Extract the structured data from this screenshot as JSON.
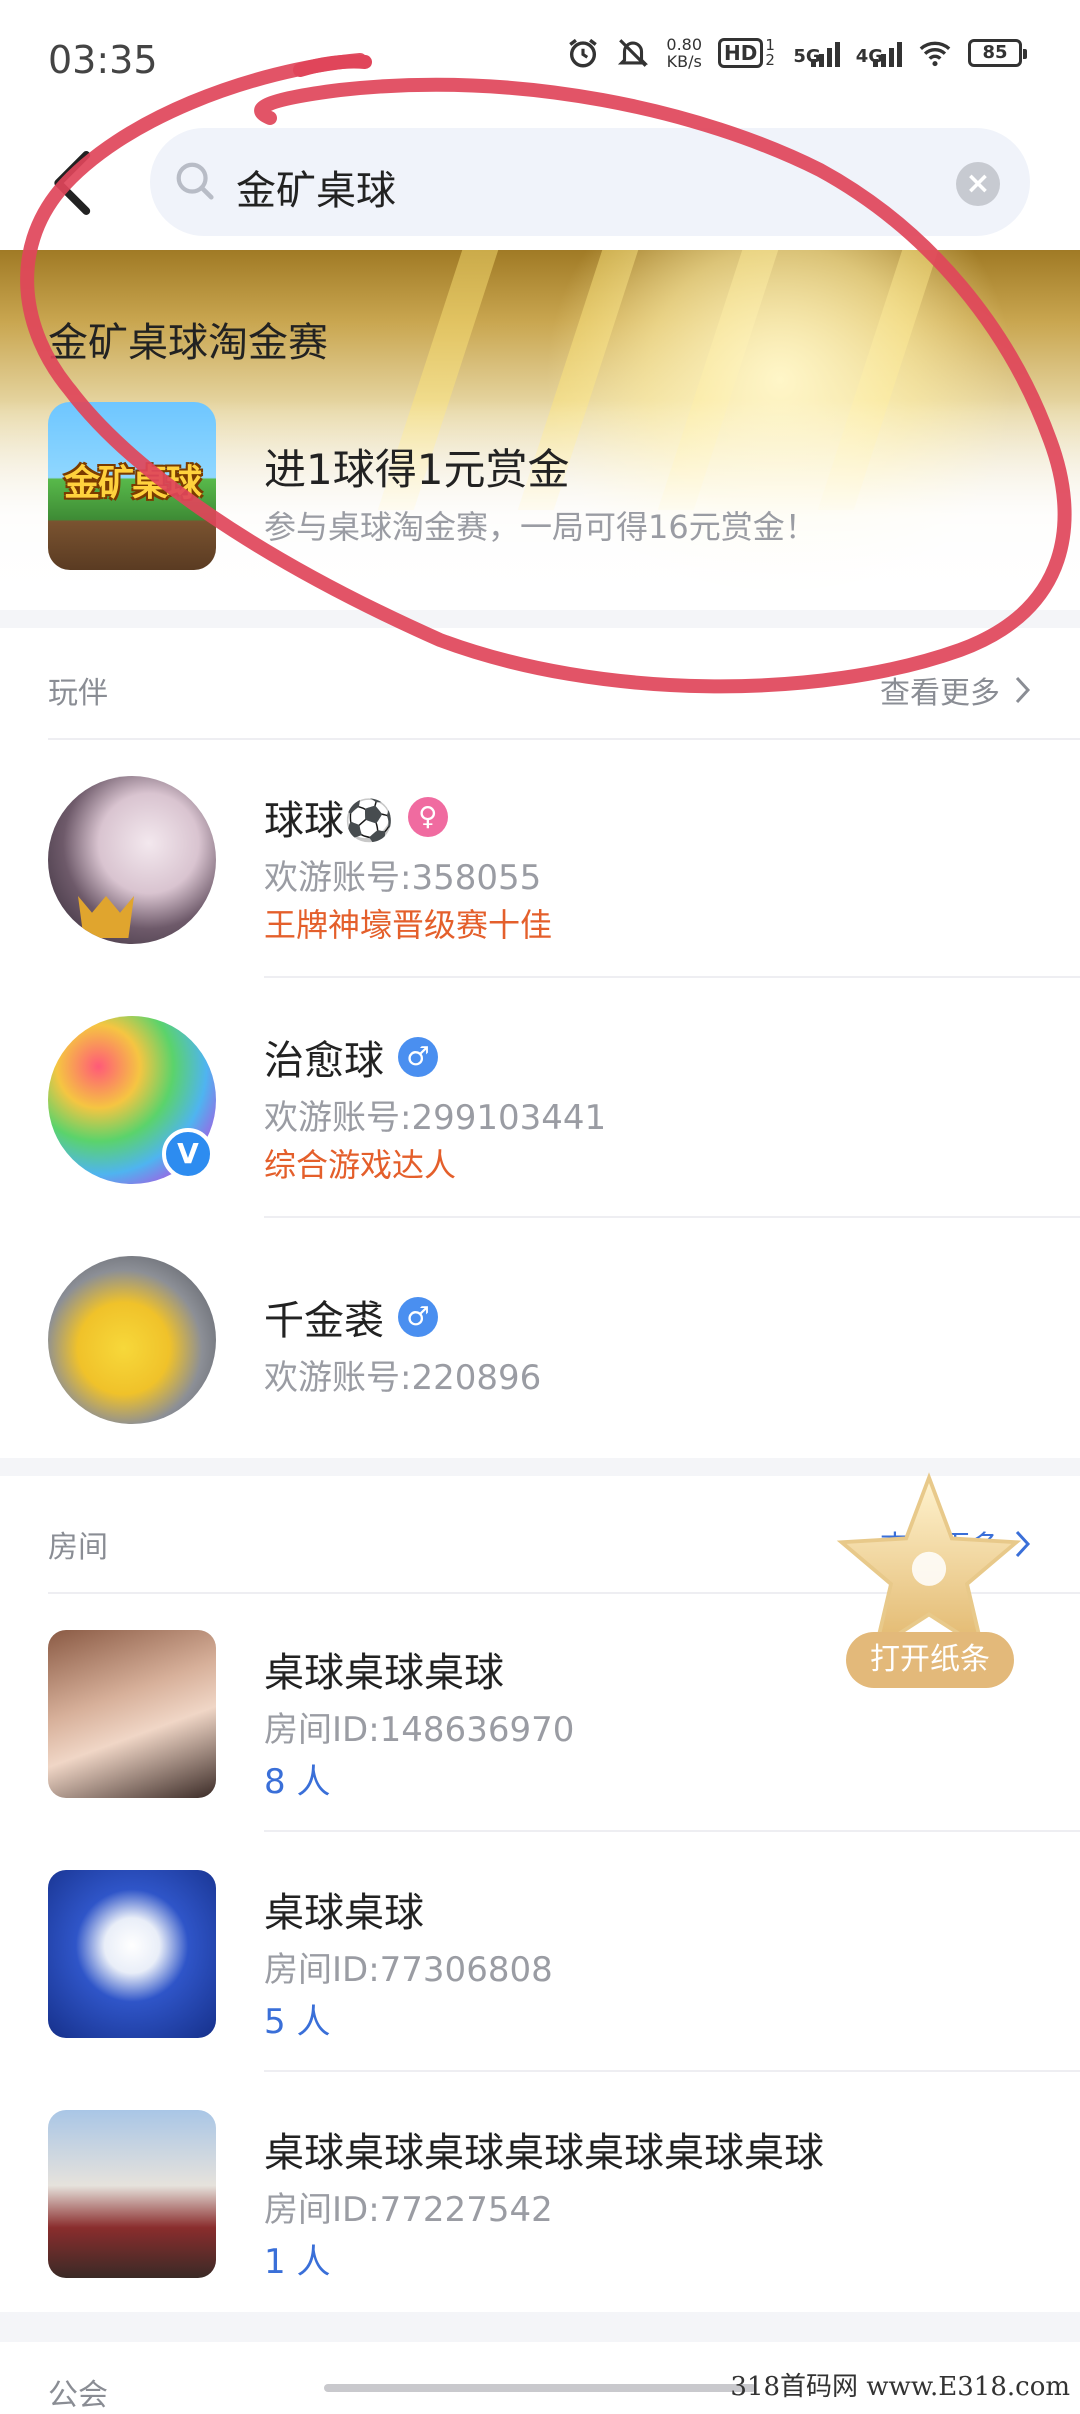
{
  "status_bar": {
    "time": "03:35",
    "net_speed_value": "0.80",
    "net_speed_unit": "KB/s",
    "hd_label": "HD",
    "hd_sub": "1 2",
    "net1": "5G",
    "net2": "4G",
    "battery": "85"
  },
  "search": {
    "query": "金矿桌球"
  },
  "banner": {
    "title": "金矿桌球淘金赛",
    "game_logo_text": "金矿桌球",
    "headline": "进1球得1元赏金",
    "subtitle": "参与桌球淘金赛，一局可得16元赏金！"
  },
  "players": {
    "section_title": "玩伴",
    "more_label": "查看更多",
    "items": [
      {
        "name": "球球⚽",
        "gender": "female",
        "gender_symbol": "♀",
        "account": "欢游账号:358055",
        "tag": "王牌神壕晋级赛十佳"
      },
      {
        "name": "治愈球",
        "gender": "male",
        "gender_symbol": "♂",
        "account": "欢游账号:299103441",
        "tag": "综合游戏达人",
        "verified": "V"
      },
      {
        "name": "千金裘",
        "gender": "male",
        "gender_symbol": "♂",
        "account": "欢游账号:220896"
      }
    ]
  },
  "rooms": {
    "section_title": "房间",
    "more_label": "查看更多",
    "items": [
      {
        "name": "桌球桌球桌球",
        "room_id": "房间ID:148636970",
        "count": "8 人"
      },
      {
        "name": "桌球桌球",
        "room_id": "房间ID:77306808",
        "count": "5 人"
      },
      {
        "name": "桌球桌球桌球桌球桌球桌球桌球",
        "room_id": "房间ID:77227542",
        "count": "1 人"
      }
    ]
  },
  "floating": {
    "label": "打开纸条"
  },
  "next_section": {
    "title": "公会"
  },
  "watermark": "318首码网 www.E318.com",
  "colors": {
    "accent_blue": "#3a6fd8",
    "tag_orange": "#e45f2b",
    "annotation_red": "#e0455a",
    "female_pink": "#f06ba0",
    "male_blue": "#4a8ff0"
  }
}
